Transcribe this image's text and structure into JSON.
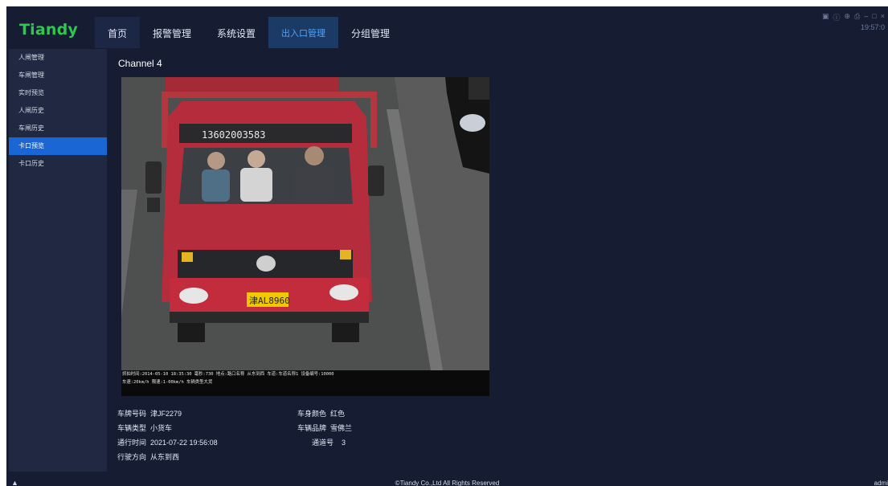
{
  "app": {
    "logo": "Tiandy",
    "time": "19:57:0"
  },
  "nav": {
    "items": [
      {
        "label": "首页"
      },
      {
        "label": "报警管理"
      },
      {
        "label": "系统设置"
      },
      {
        "label": "出入口管理"
      },
      {
        "label": "分组管理"
      }
    ],
    "active_index": 3
  },
  "window_controls": [
    "▣",
    "ⓘ",
    "⊕",
    "⎙",
    "–",
    "□",
    "×"
  ],
  "sidebar": {
    "items": [
      {
        "label": "人闸管理"
      },
      {
        "label": "车闸管理"
      },
      {
        "label": "实时预览"
      },
      {
        "label": "人闸历史"
      },
      {
        "label": "车闸历史"
      },
      {
        "label": "卡口预览"
      },
      {
        "label": "卡口历史"
      }
    ],
    "active_index": 5
  },
  "channel": {
    "title": "Channel 4"
  },
  "snapshot": {
    "truck_text": "13602003583",
    "plate_text": "津AL8960",
    "overlay_line1": "抓拍时间:2014-05-10 18:35:30 毫秒:730    地点:路口名称 从东到西    车道:车道名称1 设备编号:10000",
    "overlay_line2": "车速:20km/h 限速:1-00km/h        车辆类型大货"
  },
  "details": {
    "plate": {
      "label": "车牌号码",
      "value": "津JF2279"
    },
    "type": {
      "label": "车辆类型",
      "value": "小货车"
    },
    "time": {
      "label": "通行时间",
      "value": "2021-07-22 19:56:08"
    },
    "direction": {
      "label": "行驶方向",
      "value": "从东到西"
    },
    "color": {
      "label": "车身颜色",
      "value": "红色"
    },
    "brand": {
      "label": "车辆品牌",
      "value": "雪佛兰"
    },
    "channel_no": {
      "label": "通道号",
      "value": "3"
    }
  },
  "footer": {
    "copyright": "©Tiandy Co.,Ltd All Rights Reserved",
    "user": "admi"
  },
  "colors": {
    "background": "#161d33",
    "sidebar": "#202842",
    "active_blue": "#1a66d4",
    "logo_green": "#2dc84d",
    "nav_active_text": "#4aa3ff"
  }
}
